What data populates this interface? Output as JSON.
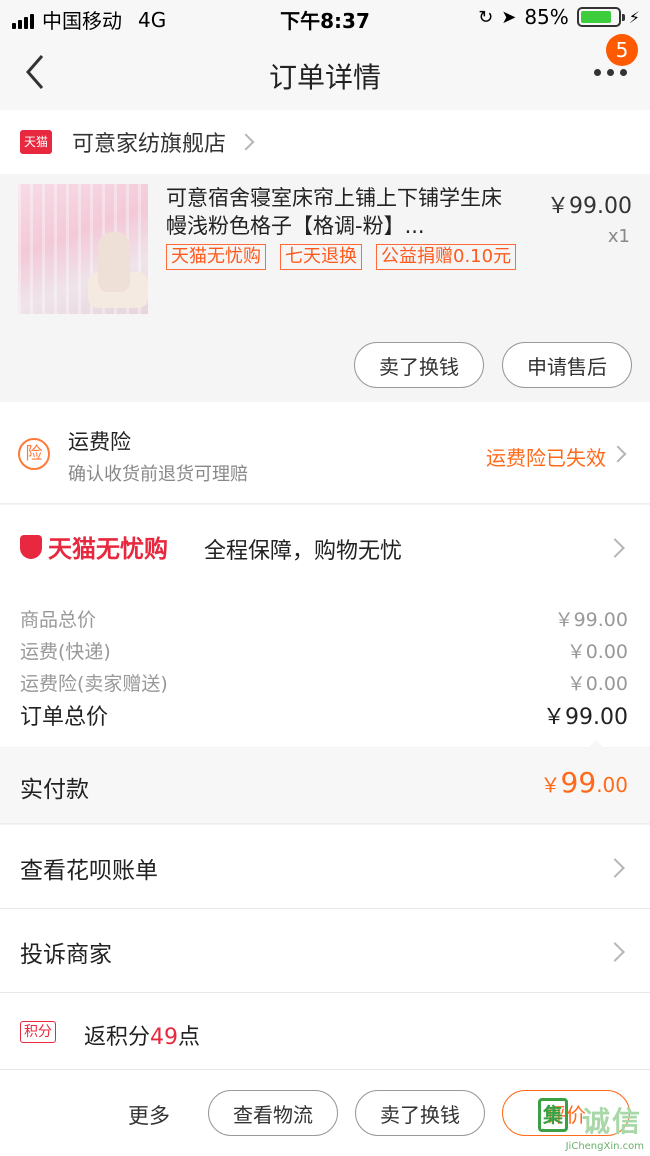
{
  "status_bar": {
    "carrier": "中国移动",
    "network": "4G",
    "time": "下午8:37",
    "battery": "85%",
    "battery_level": 0.85
  },
  "nav": {
    "title": "订单详情",
    "badge_count": "5"
  },
  "shop": {
    "logo_text": "天猫",
    "name": "可意家纺旗舰店"
  },
  "product": {
    "name": "可意宿舍寝室床帘上铺上下铺学生床幔浅粉色格子【格调-粉】...",
    "price": "￥99.00",
    "qty": "x1",
    "tags": [
      "天猫无忧购",
      "七天退换",
      "公益捐赠0.10元"
    ],
    "buttons": {
      "sell": "卖了换钱",
      "after_sale": "申请售后"
    }
  },
  "insurance": {
    "icon_text": "险",
    "title": "运费险",
    "subtitle": "确认收货前退货可理赔",
    "status": "运费险已失效"
  },
  "worry_free": {
    "logo": "天猫无忧购",
    "text": "全程保障，购物无忧"
  },
  "summary": {
    "rows": [
      {
        "label": "商品总价",
        "value": "￥99.00"
      },
      {
        "label": "运费(快递)",
        "value": "￥0.00"
      },
      {
        "label": "运费险(卖家赠送)",
        "value": "￥0.00"
      }
    ],
    "total_label": "订单总价",
    "total_value": "￥99.00"
  },
  "paid": {
    "label": "实付款",
    "currency": "￥",
    "integer": "99",
    "decimal": ".00"
  },
  "list": {
    "huabei": "查看花呗账单",
    "complain": "投诉商家"
  },
  "points": {
    "badge": "积分",
    "prefix": "返积分",
    "num": "49",
    "suffix": "点"
  },
  "bottom": {
    "more": "更多",
    "logistics": "查看物流",
    "sell": "卖了换钱",
    "review": "评价"
  },
  "watermark": {
    "char": "集",
    "text": "诚信",
    "url": "JiChengXin.com"
  },
  "colors": {
    "accent": "#ff6a1a",
    "tmall_red": "#e8283e"
  }
}
